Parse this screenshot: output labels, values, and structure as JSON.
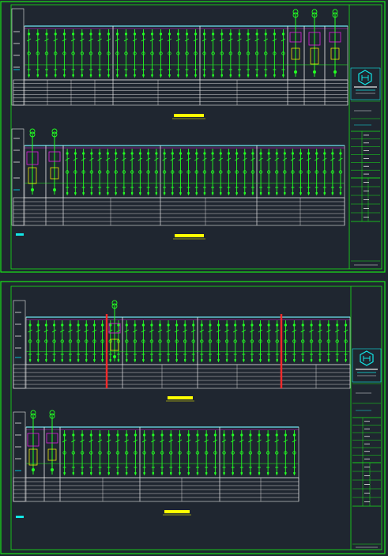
{
  "colors": {
    "background": "#1f2630",
    "frame": "#19e619",
    "circuit": "#22ff22",
    "busbar": "#00e5ff",
    "table": "#e6e6e6",
    "highlight": "#ffff00",
    "accent": "#e020e0",
    "breaker": "#ff2a2a",
    "logo": "#12e6e6"
  },
  "icons": {
    "logo": "company-logo-icon"
  },
  "sheets": [
    {
      "id": "sheet-1",
      "diagrams": [
        {
          "id": "panel-a",
          "incoming_side": "right"
        },
        {
          "id": "panel-b",
          "incoming_side": "left"
        }
      ]
    },
    {
      "id": "sheet-2",
      "diagrams": [
        {
          "id": "panel-c",
          "incoming_side": "none"
        },
        {
          "id": "panel-d",
          "incoming_side": "left"
        }
      ]
    }
  ]
}
